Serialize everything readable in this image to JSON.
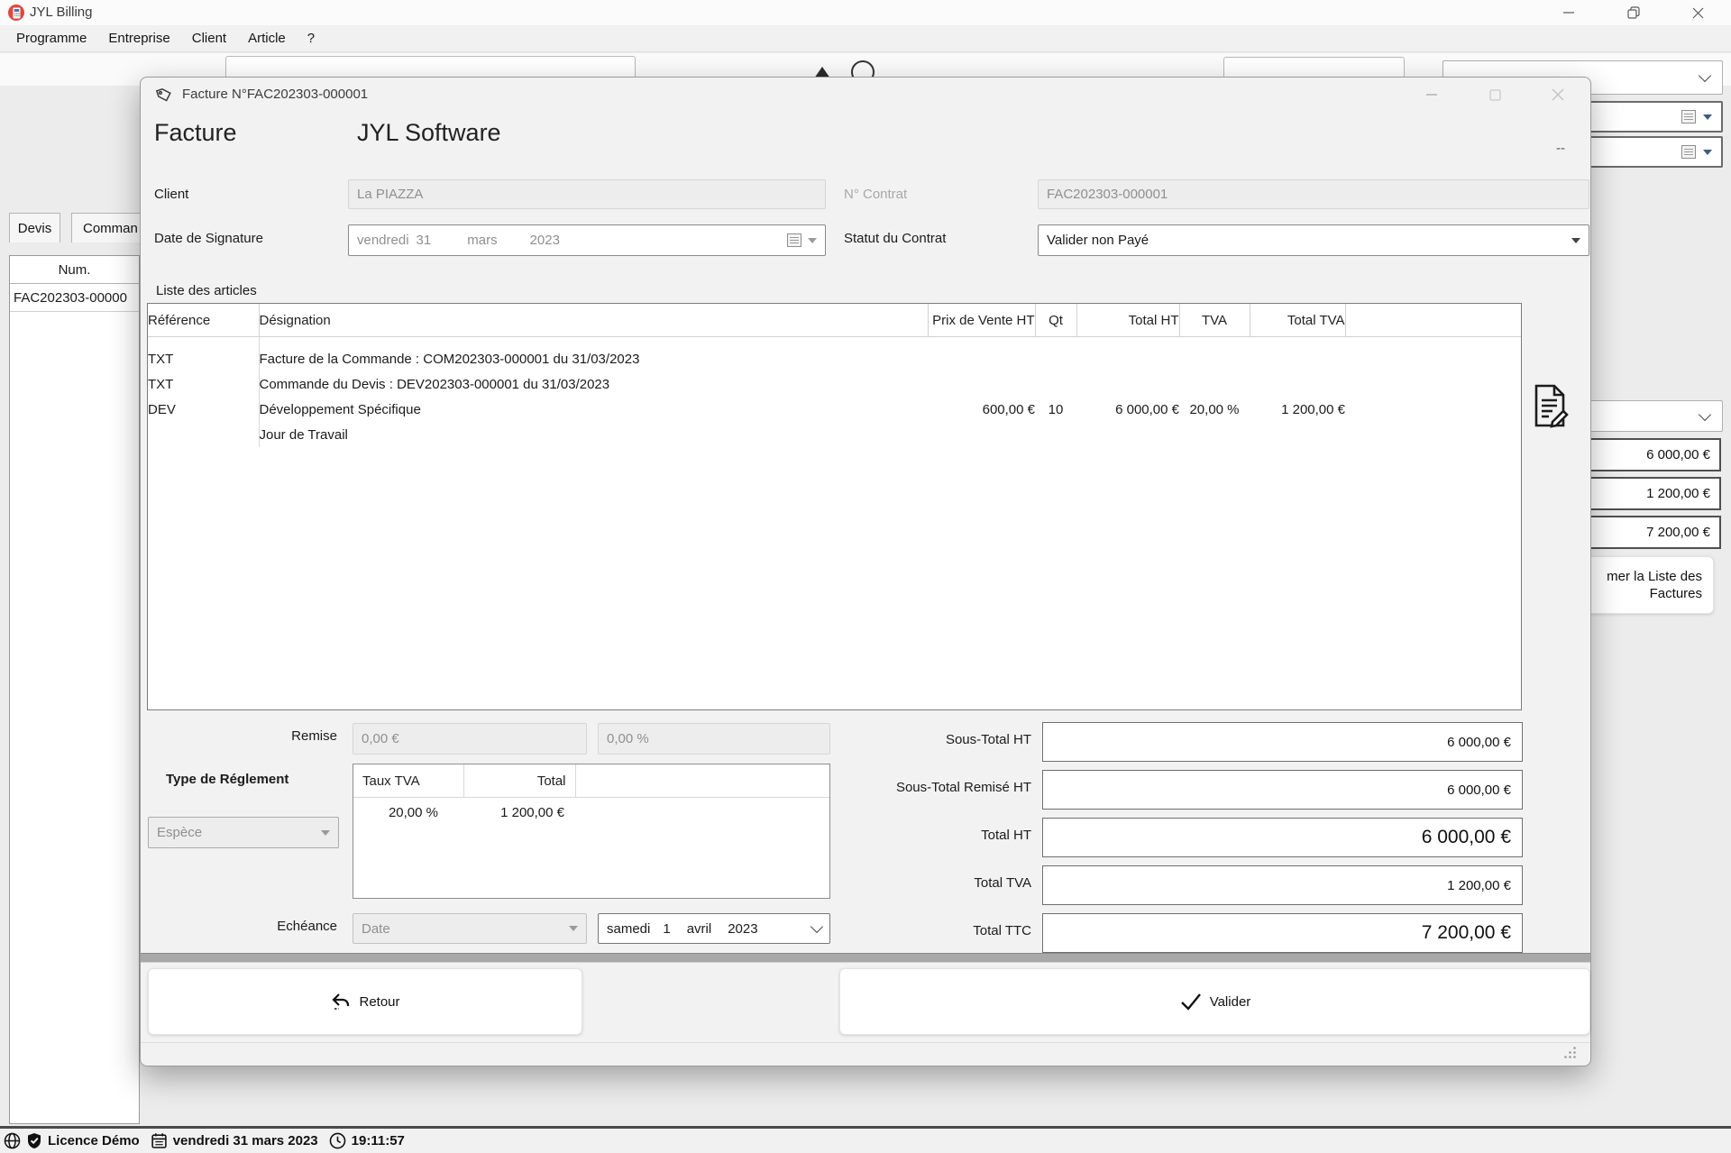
{
  "window": {
    "title": "JYL Billing",
    "menu": [
      "Programme",
      "Entreprise",
      "Client",
      "Article",
      "?"
    ]
  },
  "background": {
    "tabs": [
      "Devis",
      "Comman"
    ],
    "list": {
      "header": "Num.",
      "row": "FAC202303-00000"
    },
    "side_values": [
      "6 000,00 €",
      "1 200,00 €",
      "7 200,00 €"
    ],
    "side_button_line1": "mer la Liste des",
    "side_button_line2": "Factures"
  },
  "dialog": {
    "title": "Facture N°FAC202303-000001",
    "header": {
      "left": "Facture",
      "company": "JYL Software",
      "right": "--"
    },
    "client": {
      "label": "Client",
      "value": "La PIAZZA"
    },
    "contrat": {
      "label": "N° Contrat",
      "value": "FAC202303-000001"
    },
    "signature": {
      "label": "Date de Signature",
      "parts": [
        "vendredi",
        "31",
        "mars",
        "2023"
      ]
    },
    "statut": {
      "label": "Statut du Contrat",
      "value": "Valider non Payé"
    },
    "articles": {
      "group_label": "Liste des articles",
      "columns": {
        "ref": "Référence",
        "designation": "Désignation",
        "prix": "Prix de Vente HT",
        "qt": "Qt",
        "total_ht": "Total HT",
        "tva": "TVA",
        "total_tva": "Total TVA"
      },
      "rows": [
        {
          "ref": "TXT",
          "designation": "Facture de la Commande : COM202303-000001 du 31/03/2023",
          "prix": "",
          "qt": "",
          "total_ht": "",
          "tva": "",
          "total_tva": ""
        },
        {
          "ref": "TXT",
          "designation": "Commande du Devis : DEV202303-000001 du 31/03/2023",
          "prix": "",
          "qt": "",
          "total_ht": "",
          "tva": "",
          "total_tva": ""
        },
        {
          "ref": "DEV",
          "designation": "Développement Spécifique",
          "prix": "600,00 €",
          "qt": "10",
          "total_ht": "6 000,00 €",
          "tva": "20,00 %",
          "total_tva": "1 200,00 €"
        },
        {
          "ref": "",
          "designation": "Jour de Travail",
          "prix": "",
          "qt": "",
          "total_ht": "",
          "tva": "",
          "total_tva": ""
        }
      ]
    },
    "remise": {
      "label": "Remise",
      "amount": "0,00 €",
      "percent": "0,00 %"
    },
    "reglement": {
      "label": "Type de Réglement",
      "value": "Espèce"
    },
    "tva_summary": {
      "col_taux": "Taux TVA",
      "col_total": "Total",
      "taux": "20,00 %",
      "total": "1 200,00 €"
    },
    "echeance": {
      "label": "Echéance",
      "type": "Date",
      "parts": [
        "samedi",
        "1",
        "avril",
        "2023"
      ]
    },
    "totals": [
      {
        "label": "Sous-Total HT",
        "value": "6 000,00 €"
      },
      {
        "label": "Sous-Total Remisé HT",
        "value": "6 000,00 €"
      },
      {
        "label": "Total HT",
        "value": "6 000,00 €"
      },
      {
        "label": "Total TVA",
        "value": "1 200,00 €"
      },
      {
        "label": "Total TTC",
        "value": "7 200,00 €"
      }
    ],
    "buttons": {
      "retour": "Retour",
      "valider": "Valider"
    }
  },
  "statusbar": {
    "licence": "Licence Démo",
    "date": "vendredi 31 mars 2023",
    "time": "19:11:57"
  },
  "colors": {
    "app_icon_red": "#e0483e",
    "date_arrow_blue": "#3d5a82"
  }
}
